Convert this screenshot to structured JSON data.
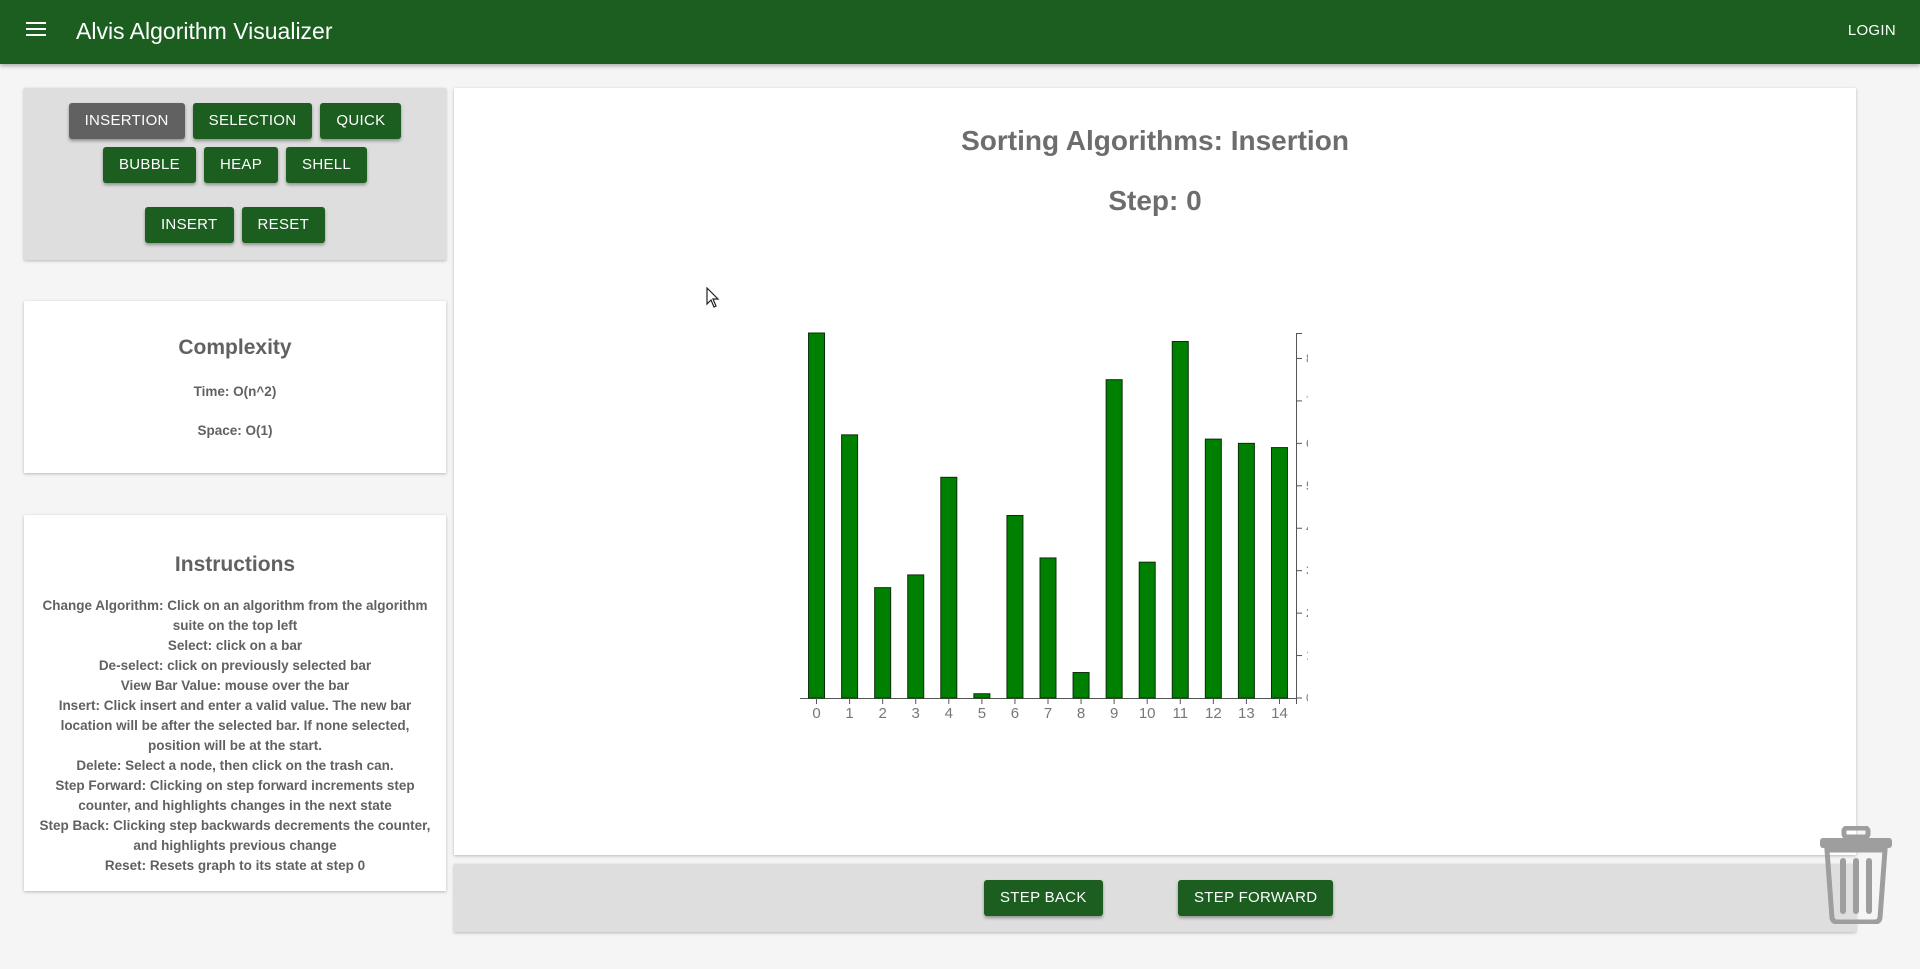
{
  "app": {
    "title": "Alvis Algorithm Visualizer",
    "login_label": "LOGIN",
    "menu_icon": "menu-icon"
  },
  "algorithms": {
    "row1": [
      "INSERTION",
      "SELECTION",
      "QUICK"
    ],
    "row2": [
      "BUBBLE",
      "HEAP",
      "SHELL"
    ],
    "selected": "INSERTION",
    "insert_label": "INSERT",
    "reset_label": "RESET"
  },
  "complexity": {
    "title": "Complexity",
    "time": "Time: O(n^2)",
    "space": "Space: O(1)"
  },
  "instructions": {
    "title": "Instructions",
    "lines": [
      "Change Algorithm: Click on an algorithm from the algorithm suite on the top left",
      "Select: click on a bar",
      "De-select: click on previously selected bar",
      "View Bar Value: mouse over the bar",
      "Insert: Click insert and enter a valid value. The new bar location will be after the selected bar. If none selected, position will be at the start.",
      "Delete: Select a node, then click on the trash can.",
      "Step Forward: Clicking on step forward increments step counter, and highlights changes in the next state",
      "Step Back: Clicking step backwards decrements the counter, and highlights previous change",
      "Reset: Resets graph to its state at step 0"
    ]
  },
  "main": {
    "title": "Sorting Algorithms: Insertion",
    "step_label": "Step: 0"
  },
  "controls": {
    "step_back": "STEP BACK",
    "step_forward": "STEP FORWARD"
  },
  "colors": {
    "primary": "#1b5e20",
    "selected_button": "#616161",
    "bar": "#008000"
  },
  "icons": {
    "trash": "trash-icon"
  },
  "chart_data": {
    "type": "bar",
    "categories": [
      "0",
      "1",
      "2",
      "3",
      "4",
      "5",
      "6",
      "7",
      "8",
      "9",
      "10",
      "11",
      "12",
      "13",
      "14"
    ],
    "values": [
      86,
      62,
      26,
      29,
      52,
      1,
      43,
      33,
      6,
      75,
      32,
      84,
      61,
      60,
      59
    ],
    "y_ticks": [
      0,
      10,
      20,
      30,
      40,
      50,
      60,
      70,
      80
    ],
    "ylim": [
      0,
      86
    ],
    "y_axis_side": "right"
  }
}
